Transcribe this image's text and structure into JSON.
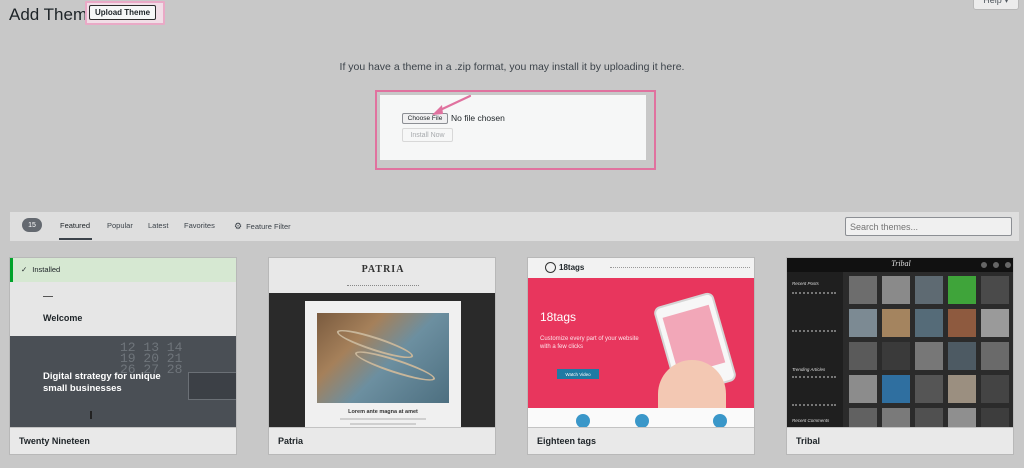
{
  "header": {
    "title": "Add Themes",
    "upload_label": "Upload Theme",
    "help_label": "Help ▾"
  },
  "upload": {
    "intro": "If you have a theme in a .zip format, you may install it by uploading it here.",
    "choose_label": "Choose File",
    "no_file_text": "No file chosen",
    "install_label": "Install Now"
  },
  "filter": {
    "count": "15",
    "tabs": [
      "Featured",
      "Popular",
      "Latest",
      "Favorites"
    ],
    "feature_filter": "Feature Filter",
    "search_placeholder": "Search themes..."
  },
  "themes": [
    {
      "name": "Twenty Nineteen",
      "installed": "Installed",
      "preview_heading": "Welcome",
      "preview_tagline": "Digital strategy for unique small businesses"
    },
    {
      "name": "Patria",
      "preview_logo": "PATRIA",
      "preview_caption": "Lorem ante magna at amet"
    },
    {
      "name": "Eighteen tags",
      "preview_logo": "18tags",
      "preview_heading": "18tags",
      "preview_sub": "Customize every part of your website with a few clicks",
      "preview_button": "Watch Video"
    },
    {
      "name": "Tribal",
      "preview_logo": "Tribal",
      "preview_side1": "Recent Posts",
      "preview_side2": "Trending Articles",
      "preview_side3": "Recent Comments"
    }
  ],
  "colors": {
    "highlight": "#e0729f",
    "tags_red": "#e8365d",
    "tribal_dark": "#1f1f1f"
  }
}
